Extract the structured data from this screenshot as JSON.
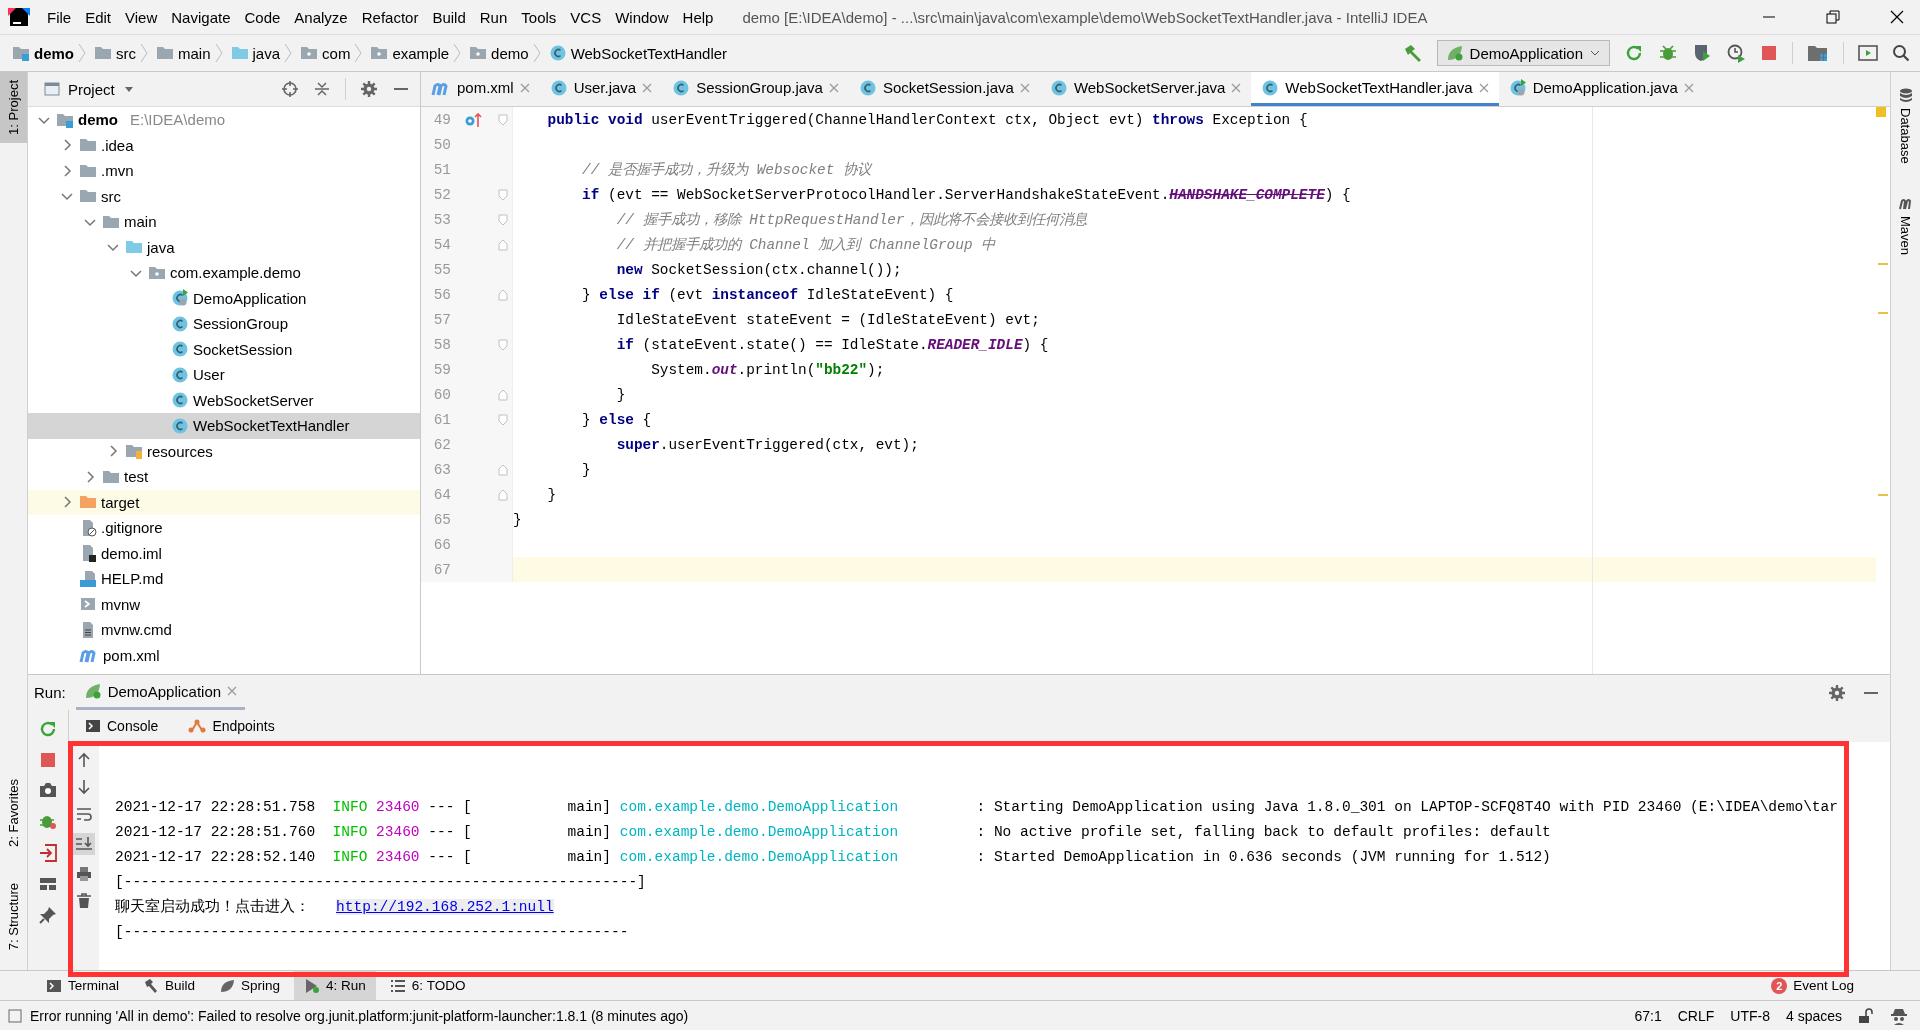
{
  "app": {
    "title": "demo [E:\\IDEA\\demo] - ...\\src\\main\\java\\com\\example\\demo\\WebSocketTextHandler.java - IntelliJ IDEA"
  },
  "menu": [
    "File",
    "Edit",
    "View",
    "Navigate",
    "Code",
    "Analyze",
    "Refactor",
    "Build",
    "Run",
    "Tools",
    "VCS",
    "Window",
    "Help"
  ],
  "breadcrumbs": [
    {
      "label": "demo",
      "kind": "module"
    },
    {
      "label": "src",
      "kind": "folder"
    },
    {
      "label": "main",
      "kind": "folder"
    },
    {
      "label": "java",
      "kind": "source-root"
    },
    {
      "label": "com",
      "kind": "package"
    },
    {
      "label": "example",
      "kind": "package"
    },
    {
      "label": "demo",
      "kind": "package"
    },
    {
      "label": "WebSocketTextHandler",
      "kind": "class"
    }
  ],
  "run_config": {
    "label": "DemoApplication"
  },
  "left_strip": [
    {
      "label": "1: Project",
      "selected": true
    },
    {
      "label": "2: Favorites",
      "selected": false
    },
    {
      "label": "7: Structure",
      "selected": false
    }
  ],
  "right_strip": [
    "Database",
    "Maven"
  ],
  "project": {
    "title": "Project",
    "tree": [
      {
        "label": "demo",
        "location": "E:\\IDEA\\demo",
        "kind": "module",
        "expanded": true,
        "selected": false,
        "children": [
          {
            "label": ".idea",
            "kind": "folder",
            "expanded": false,
            "selected": false
          },
          {
            "label": ".mvn",
            "kind": "folder",
            "expanded": false,
            "selected": false
          },
          {
            "label": "src",
            "kind": "folder",
            "expanded": true,
            "selected": false,
            "children": [
              {
                "label": "main",
                "kind": "folder",
                "expanded": true,
                "selected": false,
                "children": [
                  {
                    "label": "java",
                    "kind": "source-root",
                    "expanded": true,
                    "selected": false,
                    "children": [
                      {
                        "label": "com.example.demo",
                        "kind": "package",
                        "expanded": true,
                        "selected": false,
                        "children": [
                          {
                            "label": "DemoApplication",
                            "kind": "spring-class",
                            "selected": false
                          },
                          {
                            "label": "SessionGroup",
                            "kind": "class",
                            "selected": false
                          },
                          {
                            "label": "SocketSession",
                            "kind": "class",
                            "selected": false
                          },
                          {
                            "label": "User",
                            "kind": "class",
                            "selected": false
                          },
                          {
                            "label": "WebSocketServer",
                            "kind": "class",
                            "selected": false
                          },
                          {
                            "label": "WebSocketTextHandler",
                            "kind": "class",
                            "selected": true
                          }
                        ]
                      }
                    ]
                  },
                  {
                    "label": "resources",
                    "kind": "resources-root",
                    "expanded": false,
                    "selected": false
                  }
                ]
              },
              {
                "label": "test",
                "kind": "folder",
                "expanded": false,
                "selected": false
              }
            ]
          },
          {
            "label": "target",
            "kind": "excluded-folder",
            "expanded": false,
            "selected": false
          },
          {
            "label": ".gitignore",
            "kind": "gitignore",
            "selected": false
          },
          {
            "label": "demo.iml",
            "kind": "iml",
            "selected": false
          },
          {
            "label": "HELP.md",
            "kind": "markdown",
            "selected": false
          },
          {
            "label": "mvnw",
            "kind": "script",
            "selected": false
          },
          {
            "label": "mvnw.cmd",
            "kind": "cmd",
            "selected": false
          },
          {
            "label": "pom.xml",
            "kind": "maven",
            "selected": false
          }
        ]
      }
    ]
  },
  "editor": {
    "tabs": [
      {
        "label": "pom.xml",
        "kind": "maven",
        "selected": false
      },
      {
        "label": "User.java",
        "kind": "class",
        "selected": false
      },
      {
        "label": "SessionGroup.java",
        "kind": "class",
        "selected": false
      },
      {
        "label": "SocketSession.java",
        "kind": "class",
        "selected": false
      },
      {
        "label": "WebSocketServer.java",
        "kind": "class",
        "selected": false
      },
      {
        "label": "WebSocketTextHandler.java",
        "kind": "class",
        "selected": true
      },
      {
        "label": "DemoApplication.java",
        "kind": "spring-class",
        "selected": false
      }
    ],
    "lines": [
      {
        "number": "49",
        "markers": [
          {
            "kind": "override"
          },
          {
            "kind": "fold-open"
          }
        ],
        "current": false,
        "tokens": [
          {
            "kind": "keyword",
            "text": "    public"
          },
          {
            "kind": "keyword",
            "text": " void"
          },
          {
            "kind": "plain",
            "text": " userEventTriggered(ChannelHandlerContext ctx, Object evt) "
          },
          {
            "kind": "keyword",
            "text": "throws"
          },
          {
            "kind": "plain",
            "text": " Exception {"
          }
        ]
      },
      {
        "number": "50",
        "current": false
      },
      {
        "number": "51",
        "current": false,
        "tokens": [
          {
            "kind": "comment",
            "text": "        // 是否握手成功，升级为 Websocket 协议"
          }
        ]
      },
      {
        "number": "52",
        "markers": [
          {
            "kind": "fold-open"
          }
        ],
        "current": false,
        "tokens": [
          {
            "kind": "keyword",
            "text": "        if"
          },
          {
            "kind": "plain",
            "text": " (evt == WebSocketServerProtocolHandler.ServerHandshakeStateEvent."
          },
          {
            "kind": "deprecated-constant",
            "text": "HANDSHAKE_COMPLETE"
          },
          {
            "kind": "plain",
            "text": ") {"
          }
        ]
      },
      {
        "number": "53",
        "markers": [
          {
            "kind": "fold-open"
          }
        ],
        "current": false,
        "tokens": [
          {
            "kind": "comment",
            "text": "            // 握手成功，移除 HttpRequestHandler，因此将不会接收到任何消息"
          }
        ]
      },
      {
        "number": "54",
        "markers": [
          {
            "kind": "fold-close"
          }
        ],
        "current": false,
        "tokens": [
          {
            "kind": "comment",
            "text": "            // 并把握手成功的 Channel 加入到 ChannelGroup 中"
          }
        ]
      },
      {
        "number": "55",
        "current": false,
        "tokens": [
          {
            "kind": "keyword",
            "text": "            new"
          },
          {
            "kind": "plain",
            "text": " SocketSession(ctx.channel());"
          }
        ]
      },
      {
        "number": "56",
        "markers": [
          {
            "kind": "fold-close"
          }
        ],
        "current": false,
        "tokens": [
          {
            "kind": "plain",
            "text": "        }"
          },
          {
            "kind": "keyword",
            "text": " else"
          },
          {
            "kind": "keyword",
            "text": " if"
          },
          {
            "kind": "plain",
            "text": " (evt "
          },
          {
            "kind": "keyword",
            "text": "instanceof"
          },
          {
            "kind": "plain",
            "text": " IdleStateEvent) {"
          }
        ]
      },
      {
        "number": "57",
        "current": false,
        "tokens": [
          {
            "kind": "plain",
            "text": "            IdleStateEvent stateEvent = (IdleStateEvent) evt;"
          }
        ]
      },
      {
        "number": "58",
        "markers": [
          {
            "kind": "fold-open"
          }
        ],
        "current": false,
        "tokens": [
          {
            "kind": "keyword",
            "text": "            if"
          },
          {
            "kind": "plain",
            "text": " (stateEvent.state() == IdleState."
          },
          {
            "kind": "constant",
            "text": "READER_IDLE"
          },
          {
            "kind": "plain",
            "text": ") {"
          }
        ]
      },
      {
        "number": "59",
        "current": false,
        "tokens": [
          {
            "kind": "plain",
            "text": "                System."
          },
          {
            "kind": "constant",
            "text": "out"
          },
          {
            "kind": "plain",
            "text": ".println("
          },
          {
            "kind": "string",
            "text": "\"bb22\""
          },
          {
            "kind": "plain",
            "text": ");"
          }
        ]
      },
      {
        "number": "60",
        "markers": [
          {
            "kind": "fold-close"
          }
        ],
        "current": false,
        "tokens": [
          {
            "kind": "plain",
            "text": "            }"
          }
        ]
      },
      {
        "number": "61",
        "markers": [
          {
            "kind": "fold-open"
          }
        ],
        "current": false,
        "tokens": [
          {
            "kind": "plain",
            "text": "        }"
          },
          {
            "kind": "keyword",
            "text": " else"
          },
          {
            "kind": "plain",
            "text": " {"
          }
        ]
      },
      {
        "number": "62",
        "current": false,
        "tokens": [
          {
            "kind": "keyword",
            "text": "            super"
          },
          {
            "kind": "plain",
            "text": ".userEventTriggered(ctx, evt);"
          }
        ]
      },
      {
        "number": "63",
        "markers": [
          {
            "kind": "fold-close"
          }
        ],
        "current": false,
        "tokens": [
          {
            "kind": "plain",
            "text": "        }"
          }
        ]
      },
      {
        "number": "64",
        "markers": [
          {
            "kind": "fold-close"
          }
        ],
        "current": false,
        "tokens": [
          {
            "kind": "plain",
            "text": "    }"
          }
        ]
      },
      {
        "number": "65",
        "current": false,
        "tokens": [
          {
            "kind": "plain",
            "text": "}"
          }
        ]
      },
      {
        "number": "66",
        "current": false
      },
      {
        "number": "67",
        "current": true
      }
    ]
  },
  "run": {
    "label": "Run:",
    "tabs": [
      {
        "label": "DemoApplication",
        "selected": true
      }
    ],
    "subtabs": [
      {
        "label": "Console",
        "kind": "console"
      },
      {
        "label": "Endpoints",
        "kind": "endpoints"
      }
    ],
    "console": [
      {
        "kind": "blank"
      },
      {
        "kind": "log",
        "timestamp": "2021-12-17 22:28:51.758",
        "level": "INFO",
        "pid": "23460",
        "separator": "--- [",
        "thread": "main]",
        "logger": "com.example.demo.DemoApplication",
        "message": ": Starting DemoApplication using Java 1.8.0_301 on LAPTOP-SCFQ8T4O with PID 23460 (E:\\IDEA\\demo\\tar"
      },
      {
        "kind": "log",
        "timestamp": "2021-12-17 22:28:51.760",
        "level": "INFO",
        "pid": "23460",
        "separator": "--- [",
        "thread": "main]",
        "logger": "com.example.demo.DemoApplication",
        "message": ": No active profile set, falling back to default profiles: default"
      },
      {
        "kind": "log",
        "timestamp": "2021-12-17 22:28:52.140",
        "level": "INFO",
        "pid": "23460",
        "separator": "--- [",
        "thread": "main]",
        "logger": "com.example.demo.DemoApplication",
        "message": ": Started DemoApplication in 0.636 seconds (JVM running for 1.512)"
      },
      {
        "kind": "text",
        "text": "[-----------------------------------------------------------]"
      },
      {
        "kind": "link-line",
        "text": "聊天室启动成功！点击进入：",
        "link": "http://192.168.252.1:null"
      },
      {
        "kind": "text",
        "text": "[----------------------------------------------------------"
      }
    ]
  },
  "tool_windows": [
    {
      "label": "Terminal",
      "kind": "terminal",
      "selected": false
    },
    {
      "label": "Build",
      "kind": "build",
      "selected": false
    },
    {
      "label": "Spring",
      "kind": "spring",
      "selected": false
    },
    {
      "label": "4: Run",
      "kind": "run",
      "selected": true
    },
    {
      "label": "6: TODO",
      "kind": "todo",
      "selected": false
    }
  ],
  "event_log": {
    "label": "Event Log",
    "count": "2"
  },
  "status": {
    "message": "Error running 'All in demo': Failed to resolve org.junit.platform:junit-platform-launcher:1.8.1 (8 minutes ago)",
    "items": [
      "67:1",
      "CRLF",
      "UTF-8",
      "4 spaces"
    ]
  }
}
